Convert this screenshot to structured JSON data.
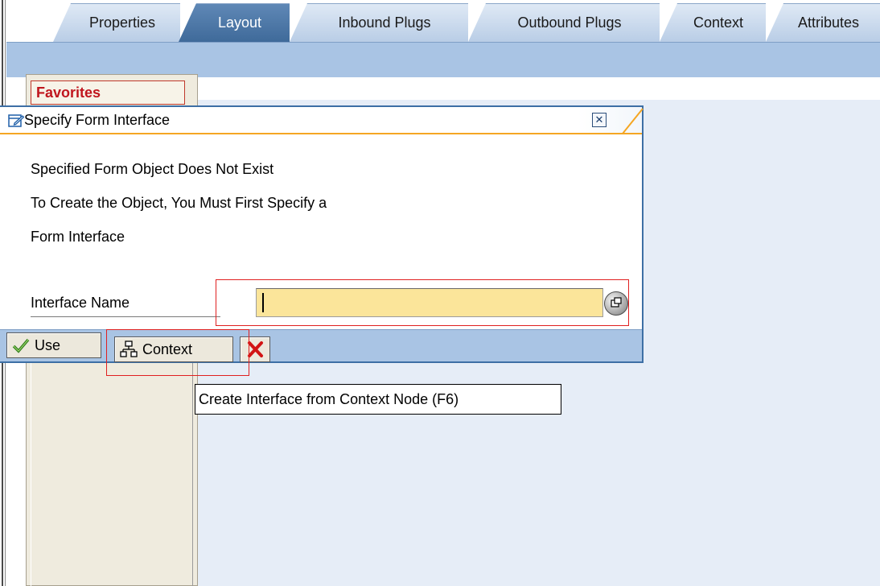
{
  "tabs": [
    {
      "label": "Properties",
      "active": false
    },
    {
      "label": "Layout",
      "active": true
    },
    {
      "label": "Inbound Plugs",
      "active": false
    },
    {
      "label": "Outbound Plugs",
      "active": false
    },
    {
      "label": "Context",
      "active": false
    },
    {
      "label": "Attributes",
      "active": false
    }
  ],
  "sidebar": {
    "favorites_label": "Favorites"
  },
  "dialog": {
    "title": "Specify Form Interface",
    "message_lines": [
      "Specified Form Object Does Not Exist",
      "To Create the Object, You Must First Specify a",
      "Form Interface"
    ],
    "field_label": "Interface Name",
    "field_value": "",
    "buttons": {
      "use_label": "Use",
      "context_label": "Context"
    },
    "tooltip": "Create Interface from Context Node  (F6)"
  },
  "colors": {
    "tab_active": "#3f6a9a",
    "tab_inactive": "#c7d7ec",
    "toolbar": "#a9c4e4",
    "input_bg": "#fbe59a",
    "highlight": "#e02020",
    "favorites_text": "#c0161e"
  },
  "icons": {
    "dialog": "dialog-edit-icon",
    "close": "close-icon",
    "value_help": "value-help-icon",
    "use": "checkmark-icon",
    "context": "hierarchy-icon",
    "cancel": "cancel-x-icon"
  }
}
